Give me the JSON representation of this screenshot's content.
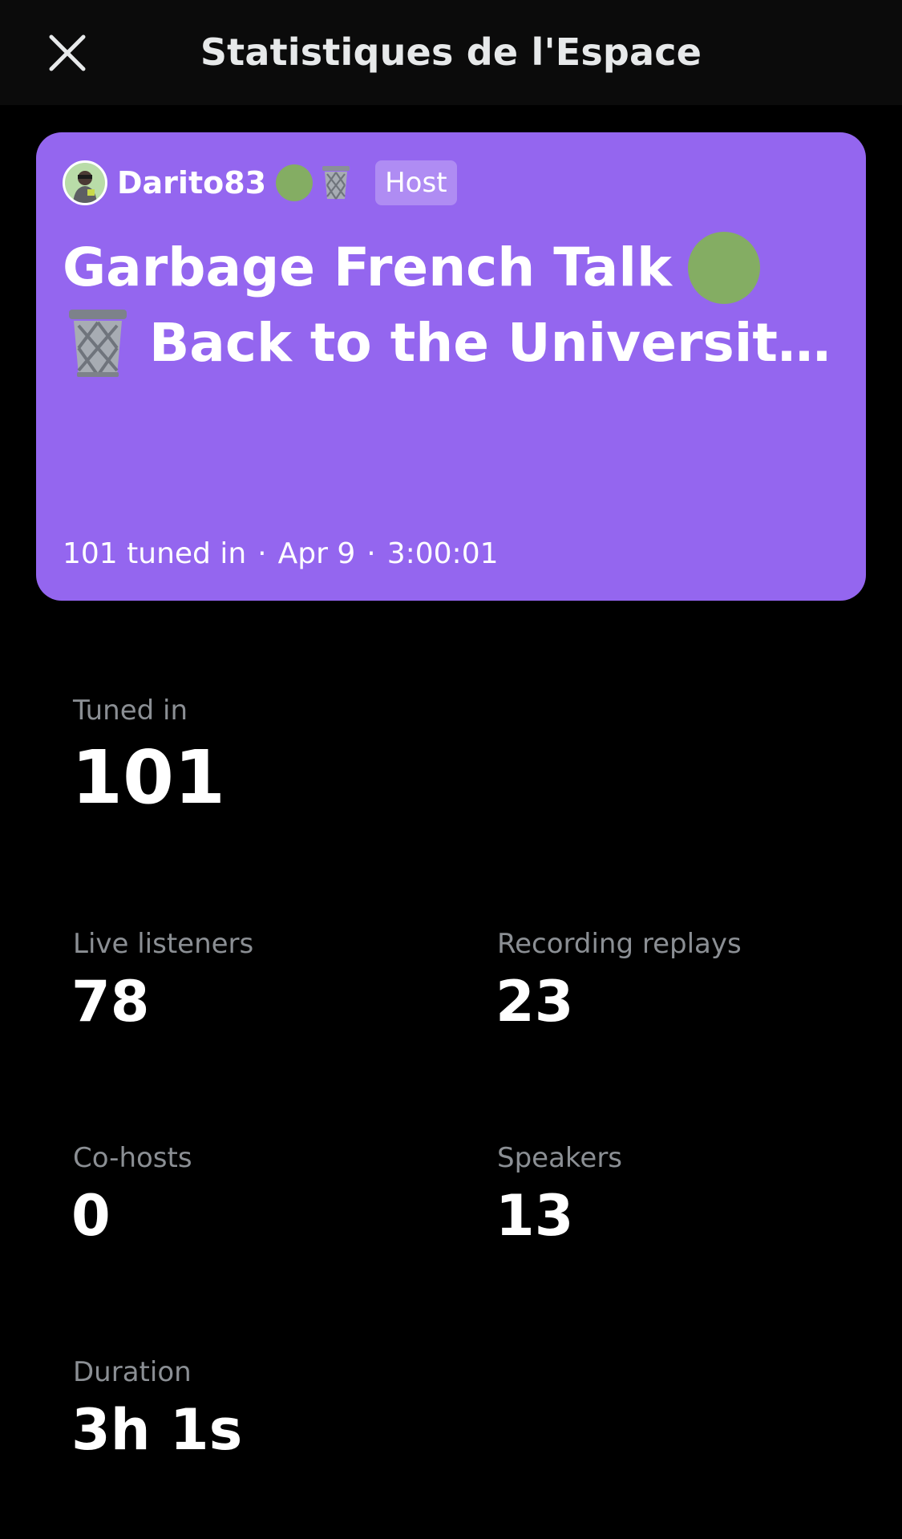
{
  "header": {
    "title": "Statistiques de l'Espace",
    "close_icon": "close-icon"
  },
  "space_card": {
    "background_color": "#9466ef",
    "host": {
      "name": "Darito83",
      "badge": "Host",
      "emoji_icons": [
        "green-circle-icon",
        "wastebasket-icon"
      ]
    },
    "title_line1": "Garbage French Talk",
    "title_line2": "Back to the Universit…",
    "meta": {
      "tuned_in": "101 tuned in",
      "date": "Apr 9",
      "length": "3:00:01",
      "separator": "·"
    }
  },
  "stats": {
    "tuned_in": {
      "label": "Tuned in",
      "value": "101"
    },
    "live_listeners": {
      "label": "Live listeners",
      "value": "78"
    },
    "recording_replays": {
      "label": "Recording replays",
      "value": "23"
    },
    "co_hosts": {
      "label": "Co-hosts",
      "value": "0"
    },
    "speakers": {
      "label": "Speakers",
      "value": "13"
    },
    "duration": {
      "label": "Duration",
      "value": "3h 1s"
    }
  }
}
